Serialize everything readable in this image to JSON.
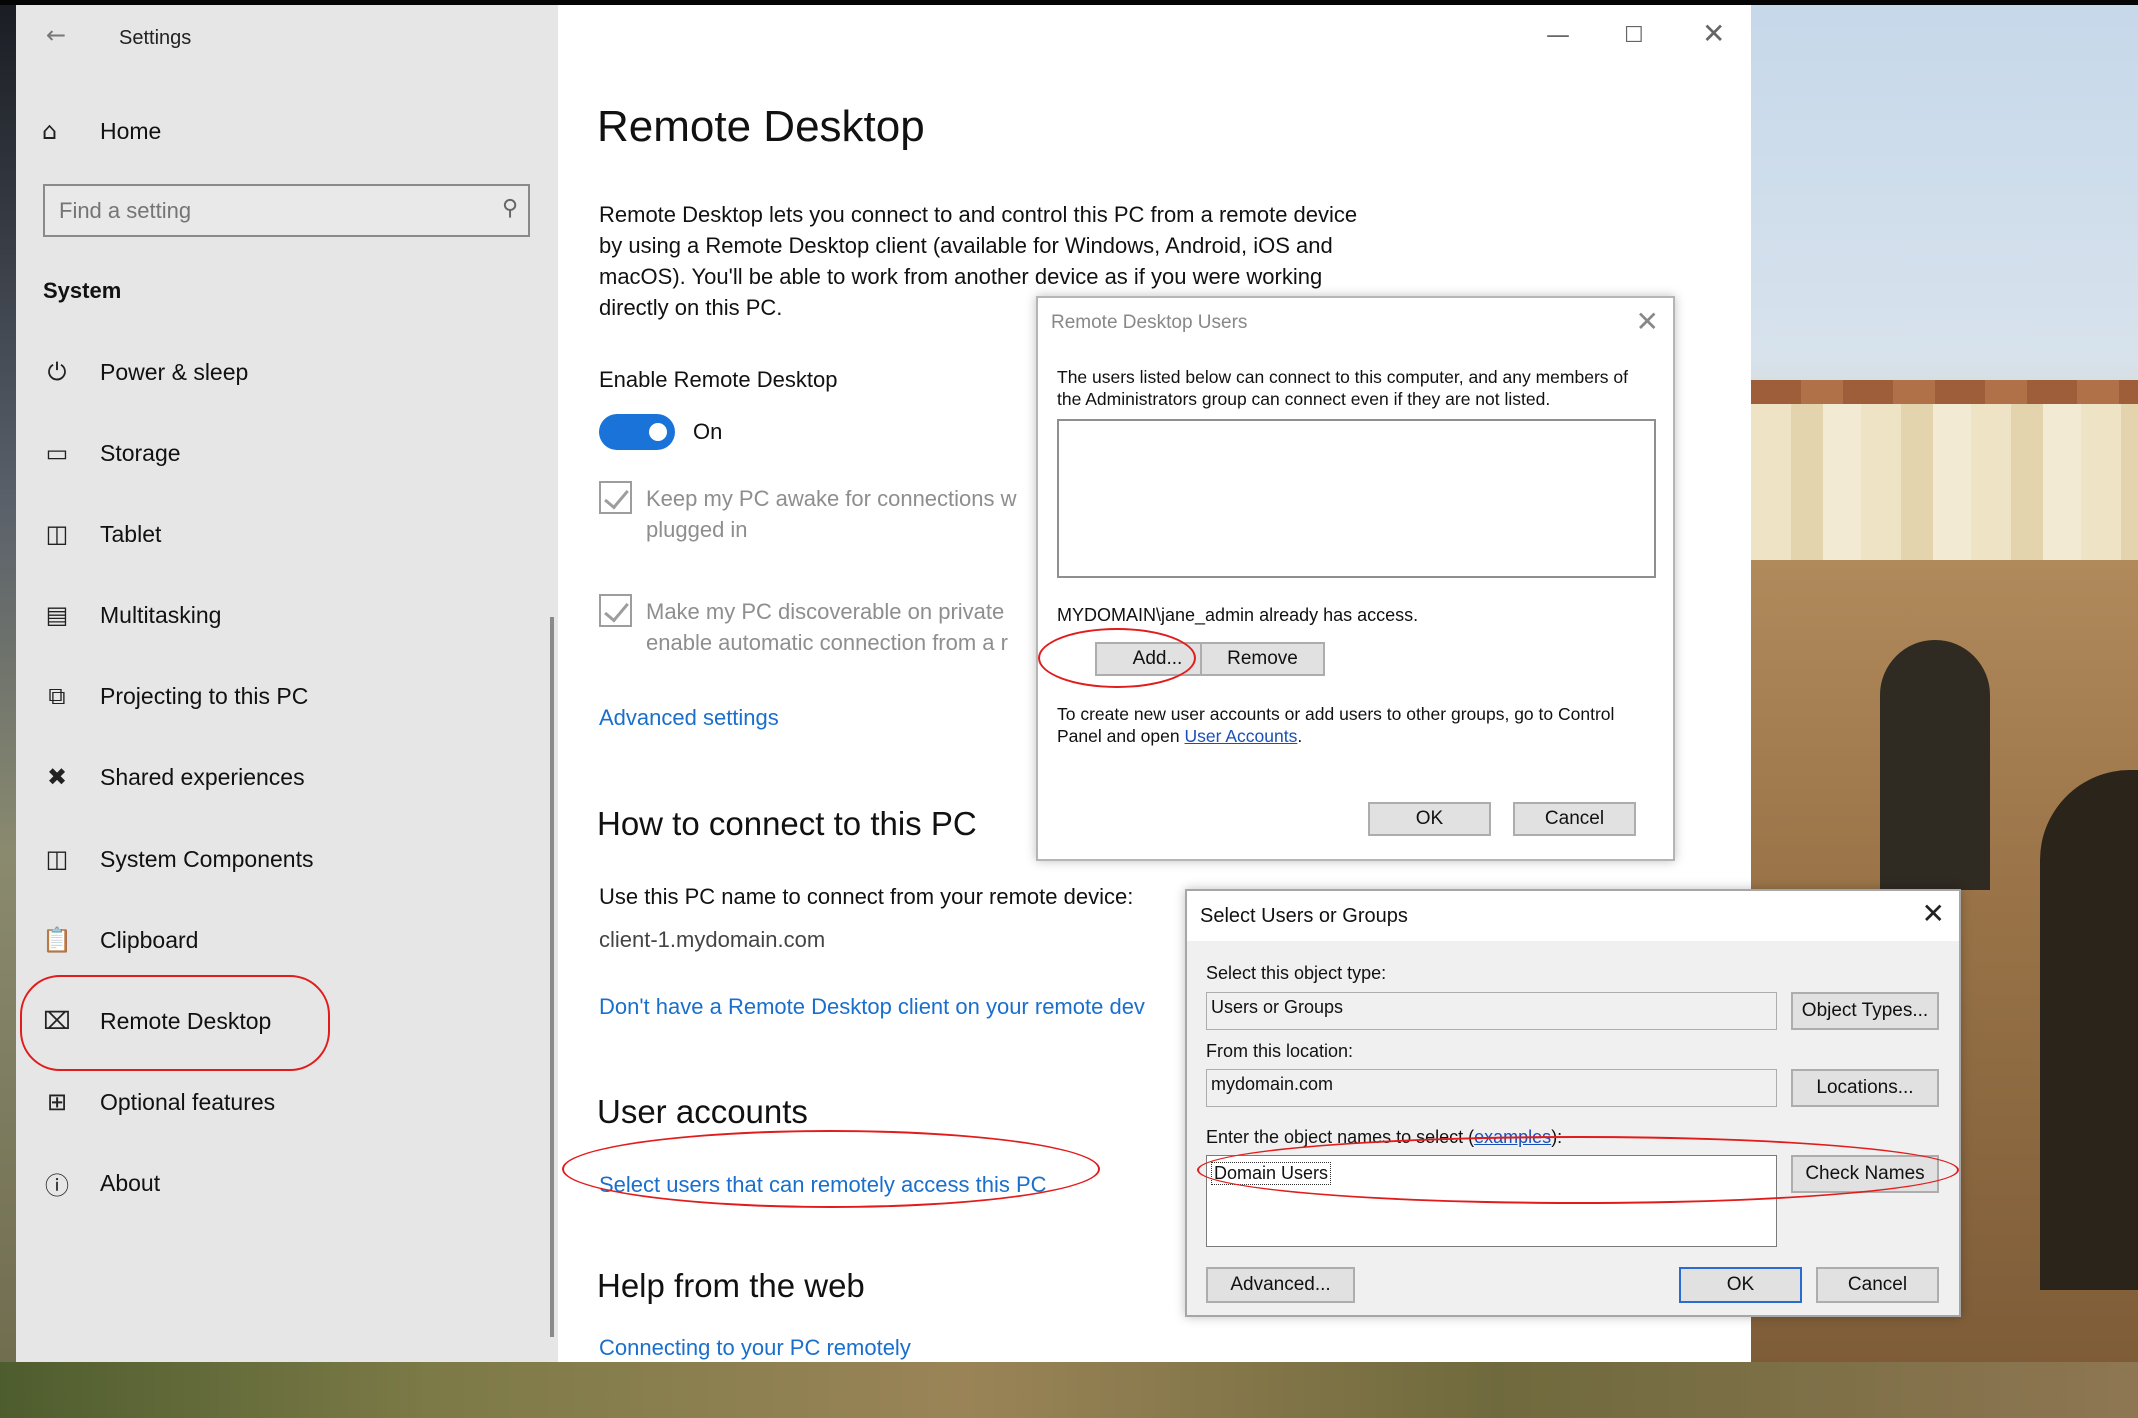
{
  "settings": {
    "app_title": "Settings",
    "home_label": "Home",
    "search_placeholder": "Find a setting",
    "section_label": "System",
    "nav": [
      {
        "label": "Power & sleep",
        "icon": "power-icon"
      },
      {
        "label": "Storage",
        "icon": "storage-icon"
      },
      {
        "label": "Tablet",
        "icon": "tablet-icon"
      },
      {
        "label": "Multitasking",
        "icon": "multitasking-icon"
      },
      {
        "label": "Projecting to this PC",
        "icon": "projecting-icon"
      },
      {
        "label": "Shared experiences",
        "icon": "shared-experiences-icon"
      },
      {
        "label": "System Components",
        "icon": "system-components-icon"
      },
      {
        "label": "Clipboard",
        "icon": "clipboard-icon"
      },
      {
        "label": "Remote Desktop",
        "icon": "remote-desktop-icon"
      },
      {
        "label": "Optional features",
        "icon": "optional-features-icon"
      },
      {
        "label": "About",
        "icon": "about-icon"
      }
    ]
  },
  "content": {
    "title": "Remote Desktop",
    "description": "Remote Desktop lets you connect to and control this PC from a remote device by using a Remote Desktop client (available for Windows, Android, iOS and macOS). You'll be able to work from another device as if you were working directly on this PC.",
    "enable_label": "Enable Remote Desktop",
    "toggle_state": "On",
    "check1_text": "Keep my PC awake for connections w",
    "check1_text2": "plugged in",
    "check2_text": "Make my PC discoverable on private",
    "check2_text2": "enable automatic connection from a r",
    "advanced_link": "Advanced settings",
    "connect_heading": "How to connect to this PC",
    "connect_text": "Use this PC name to connect from your remote device:",
    "pc_name": "client-1.mydomain.com",
    "client_link": "Don't have a Remote Desktop client on your remote dev",
    "accounts_heading": "User accounts",
    "accounts_link": "Select users that can remotely access this PC",
    "help_heading": "Help from the web",
    "help_link": "Connecting to your PC remotely"
  },
  "rdu_dialog": {
    "title": "Remote Desktop Users",
    "note": "The users listed below can connect to this computer, and any members of the Administrators group can connect even if they are not listed.",
    "access_text": "MYDOMAIN\\jane_admin already has access.",
    "add_button": "Add...",
    "remove_button": "Remove",
    "info_text": "To create new user accounts or add users to other groups, go to Control Panel and open",
    "info_link": "User Accounts",
    "ok_button": "OK",
    "cancel_button": "Cancel"
  },
  "sug_dialog": {
    "title": "Select Users or Groups",
    "object_type_label": "Select this object type:",
    "object_type_value": "Users or Groups",
    "object_types_button": "Object Types...",
    "location_label": "From this location:",
    "location_value": "mydomain.com",
    "locations_button": "Locations...",
    "names_label_pre": "Enter the object names to select (",
    "names_label_link": "examples",
    "names_label_post": "):",
    "names_value": "Domain Users",
    "check_names_button": "Check Names",
    "advanced_button": "Advanced...",
    "ok_button": "OK",
    "cancel_button": "Cancel"
  },
  "colors": {
    "accent": "#1a73d9",
    "link": "#1a6fcc",
    "annotation": "#e21b1b"
  }
}
